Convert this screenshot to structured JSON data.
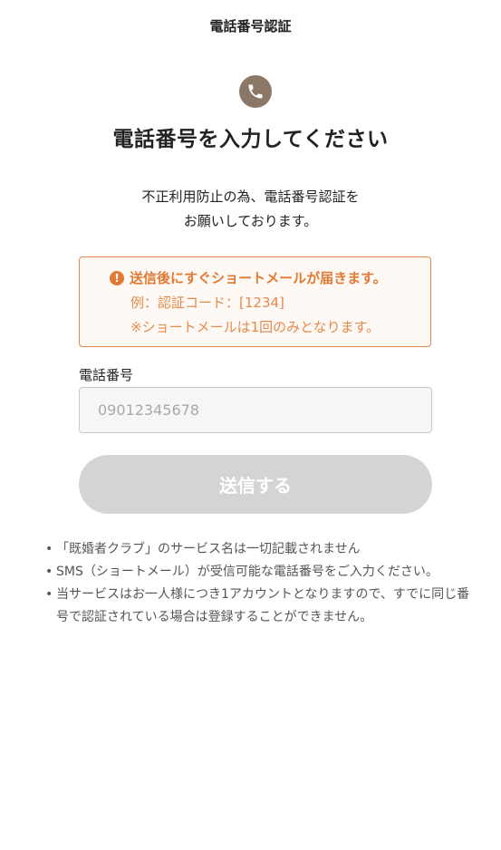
{
  "header": {
    "title": "電話番号認証"
  },
  "main": {
    "heading": "電話番号を入力してください",
    "description": [
      "不正利用防止の為、電話番号認証を",
      "お願いしております。"
    ]
  },
  "notice": {
    "headline": "送信後にすぐショートメールが届きます。",
    "line1": "例：認証コード：[1234]",
    "line2": "※ショートメールは1回のみとなります。"
  },
  "form": {
    "phone_label": "電話番号",
    "phone_placeholder": "09012345678",
    "phone_value": "",
    "submit_label": "送信する"
  },
  "notes": [
    "「既婚者クラブ」のサービス名は一切記載されません",
    "SMS（ショートメール）が受信可能な電話番号をご入力ください。",
    "当サービスはお一人様につき1アカウントとなりますので、すでに同じ番号で認証されている場合は登録することができません。"
  ],
  "colors": {
    "accent": "#e07a35",
    "icon_bg": "#8a7766",
    "button_disabled": "#d3d4d4"
  },
  "icons": {
    "header_icon": "phone-icon",
    "notice_icon": "exclamation-circle-icon"
  }
}
